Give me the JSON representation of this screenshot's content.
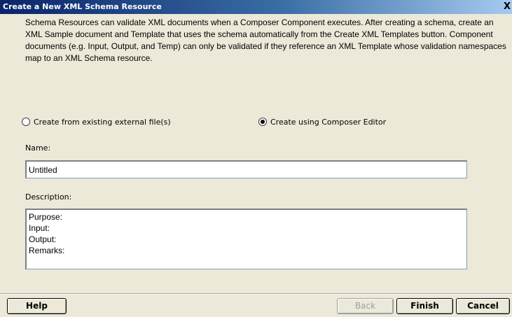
{
  "window": {
    "title": "Create a New XML Schema Resource",
    "close_label": "X"
  },
  "intro_text": "Schema Resources can validate XML documents when a Composer Component executes.  After creating a schema, create an XML Sample document and Template that uses the schema automatically from the Create XML Templates button.  Component documents (e.g. Input, Output, and Temp) can only be validated if they reference an XML Template whose validation namespaces map to an XML Schema resource.",
  "options": {
    "external_label": "Create from existing external file(s)",
    "editor_label": "Create using Composer Editor",
    "selected": "editor"
  },
  "name_field": {
    "label": "Name:",
    "value": "Untitled"
  },
  "description_field": {
    "label": "Description:",
    "value": "Purpose:\nInput:\nOutput:\nRemarks:"
  },
  "buttons": {
    "help": "Help",
    "back": "Back",
    "finish": "Finish",
    "cancel": "Cancel"
  }
}
